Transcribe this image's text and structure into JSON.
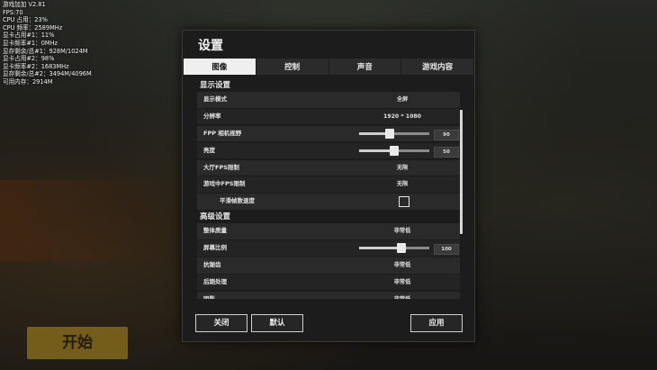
{
  "overlay_stats": [
    "游戏加加 V2.81",
    "FPS:70",
    "CPU 占用：23%",
    "CPU 频率：2589MHz",
    "显卡占用#1：11%",
    "显卡频率#1：0MHz",
    "显存剩余/总#1：928M/1024M",
    "显卡占用#2：98%",
    "显卡频率#2：1683MHz",
    "显存剩余/总#2：3494M/4096M",
    "可用内存：2914M"
  ],
  "background": {
    "start_button": "开始"
  },
  "dialog": {
    "title": "设置",
    "tabs": [
      "图像",
      "控制",
      "声音",
      "游戏内容"
    ],
    "active_tab": "图像",
    "sections": {
      "display": {
        "title": "显示设置",
        "rows": [
          {
            "label": "显示模式",
            "value": "全屏"
          },
          {
            "label": "分辨率",
            "value": "1920 * 1080"
          },
          {
            "label": "FPP 相机视野",
            "slider_value": "90",
            "fraction": 0.44
          },
          {
            "label": "亮度",
            "slider_value": "50",
            "fraction": 0.5
          },
          {
            "label": "大厅FPS限制",
            "value": "无限"
          },
          {
            "label": "游戏中FPS限制",
            "value": "无限"
          },
          {
            "label": "平滑帧数速度",
            "checked": false
          }
        ]
      },
      "advanced": {
        "title": "高级设置",
        "rows": [
          {
            "label": "整体质量",
            "value": "非常低"
          },
          {
            "label": "屏幕比例",
            "slider_value": "100",
            "fraction": 0.6
          },
          {
            "label": "抗锯齿",
            "value": "非常低"
          },
          {
            "label": "后期处理",
            "value": "非常低"
          },
          {
            "label": "阴影",
            "value": "非常低"
          }
        ]
      }
    },
    "buttons": {
      "close": "关闭",
      "default": "默认",
      "apply": "应用"
    }
  },
  "colors": {
    "dialog_bg": "#1c1c1c",
    "row_bg": "#2a2a2a",
    "active_tab": "#efefef"
  }
}
